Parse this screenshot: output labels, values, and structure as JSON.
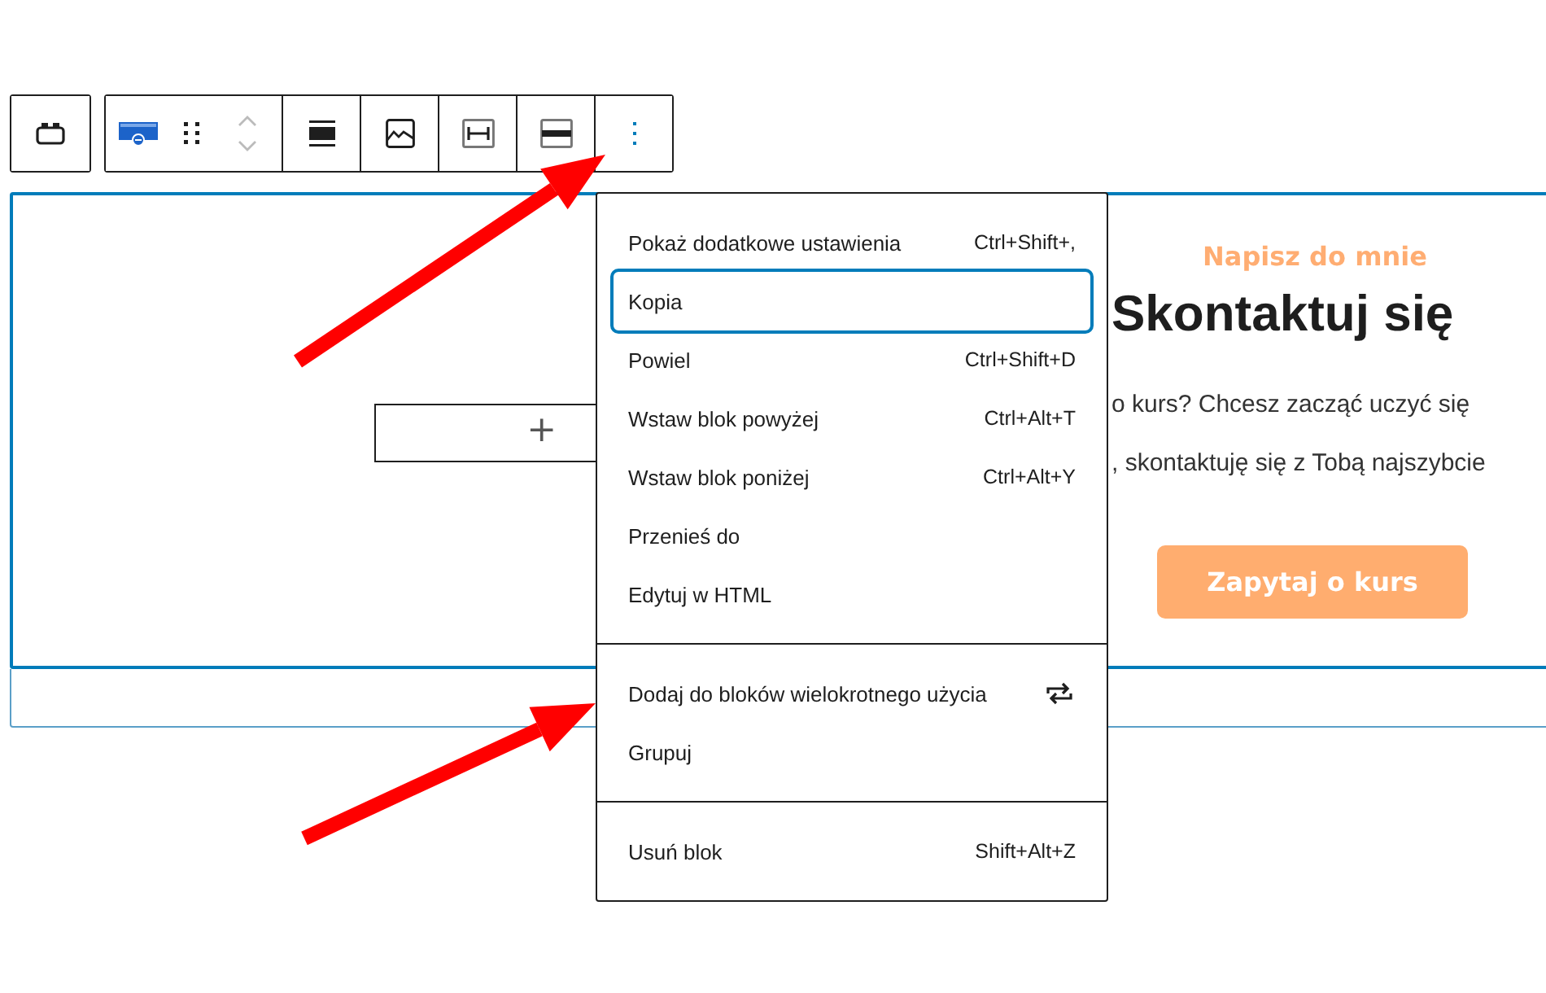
{
  "toolbar": {
    "more_options": {
      "expanded": true
    }
  },
  "block": {
    "selected": true,
    "left_column": {
      "add_button": "+"
    },
    "right_column": {
      "eyebrow": "Napisz do mnie",
      "heading": "Skontaktuj się",
      "paragraph_lines": [
        "o kurs? Chcesz zacząć uczyć się",
        ", skontaktuję się z Tobą najszybcie"
      ],
      "button": "Zapytaj o kurs"
    }
  },
  "menu": {
    "sections": [
      {
        "items": [
          {
            "kind": "text",
            "label": "Pokaż dodatkowe ustawienia",
            "shortcut": "Ctrl+Shift+,",
            "selected": false
          },
          {
            "kind": "text",
            "label": "Kopia",
            "selected": true
          },
          {
            "kind": "text",
            "label": "Powiel",
            "shortcut": "Ctrl+Shift+D",
            "selected": false
          },
          {
            "kind": "text",
            "label": "Wstaw blok powyżej",
            "shortcut": "Ctrl+Alt+T",
            "selected": false
          },
          {
            "kind": "text",
            "label": "Wstaw blok poniżej",
            "shortcut": "Ctrl+Alt+Y",
            "selected": false
          },
          {
            "kind": "text",
            "label": "Przenieś do",
            "selected": false
          },
          {
            "kind": "text",
            "label": "Edytuj w HTML",
            "selected": false
          }
        ]
      },
      {
        "items": [
          {
            "kind": "icon",
            "label": "Dodaj do bloków wielokrotnego użycia",
            "selected": false
          },
          {
            "kind": "text",
            "label": "Grupuj",
            "selected": false
          }
        ]
      },
      {
        "items": [
          {
            "kind": "text",
            "label": "Usuń blok",
            "shortcut": "Shift+Alt+Z",
            "selected": false
          }
        ]
      }
    ]
  }
}
